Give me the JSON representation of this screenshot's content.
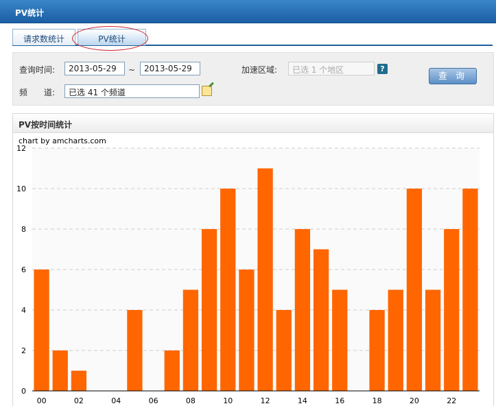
{
  "window": {
    "title": "PV统计"
  },
  "tabs": [
    {
      "label": "请求数统计",
      "active": false
    },
    {
      "label": "PV统计",
      "active": true
    }
  ],
  "filters": {
    "query_time_label": "查询时间:",
    "start_date": "2013-05-29",
    "range_separator": "~",
    "end_date": "2013-05-29",
    "region_label": "加速区域:",
    "region_value": "已选 1 个地区",
    "help_glyph": "?",
    "channel_label_1": "频",
    "channel_label_2": "道:",
    "channel_value": "已选 41 个频道",
    "query_button": "查 询"
  },
  "chart_panel": {
    "title": "PV按时间统计",
    "credit": "chart by amcharts.com"
  },
  "chart_data": {
    "type": "bar",
    "categories": [
      "00",
      "01",
      "02",
      "03",
      "04",
      "05",
      "06",
      "07",
      "08",
      "09",
      "10",
      "11",
      "12",
      "13",
      "14",
      "15",
      "16",
      "17",
      "18",
      "19",
      "20",
      "21",
      "22",
      "23"
    ],
    "values": [
      6,
      2,
      1,
      0,
      0,
      4,
      0,
      2,
      5,
      8,
      10,
      6,
      11,
      4,
      8,
      7,
      5,
      0,
      4,
      5,
      10,
      5,
      8,
      10
    ],
    "tick_labels_shown": [
      "00",
      "02",
      "04",
      "06",
      "08",
      "10",
      "12",
      "14",
      "16",
      "18",
      "20",
      "22"
    ],
    "yticks": [
      0,
      2,
      4,
      6,
      8,
      10,
      12
    ],
    "ylim": [
      0,
      12
    ],
    "grid": true,
    "bar_color": "#ff6600",
    "title": "",
    "xlabel": "",
    "ylabel": ""
  },
  "colors": {
    "title_bar": "#1b5ea3",
    "bar": "#ff6600",
    "query_button": "#5d8fc6",
    "tab_highlight_circle": "#c8202a"
  }
}
